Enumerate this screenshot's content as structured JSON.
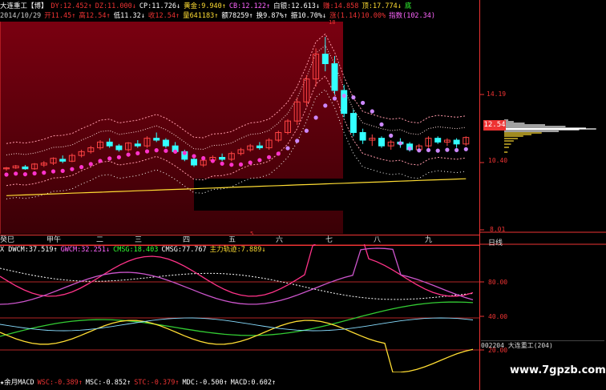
{
  "header": {
    "row1": [
      {
        "text": "大连重工【博】",
        "color": "#ffffff"
      },
      {
        "text": "DY:12.452↑",
        "color": "#e33"
      },
      {
        "text": "DZ:11.000↓",
        "color": "#e33"
      },
      {
        "text": "CP:11.726↓",
        "color": "#ffffff"
      },
      {
        "text": "黄金:9.940↑",
        "color": "#ffdd33"
      },
      {
        "text": "CB:12.122↑",
        "color": "#ff66ff"
      },
      {
        "text": "白银:12.613↓",
        "color": "#ffffff"
      },
      {
        "text": "赚:14.858",
        "color": "#e33"
      },
      {
        "text": "顶:17.774↓",
        "color": "#ffdd33"
      },
      {
        "text": "底",
        "color": "#33ff33"
      }
    ],
    "row2": [
      {
        "text": "2014/10/29",
        "color": "#cccccc"
      },
      {
        "text": "开11.45↑",
        "color": "#e33"
      },
      {
        "text": "高12.54↑",
        "color": "#e33"
      },
      {
        "text": "低11.32↓",
        "color": "#ffffff"
      },
      {
        "text": "收12.54↑",
        "color": "#e33"
      },
      {
        "text": "量641183↑",
        "color": "#ffdd33"
      },
      {
        "text": "额78259↑",
        "color": "#ffffff"
      },
      {
        "text": "换9.87%↑",
        "color": "#ffffff"
      },
      {
        "text": "振10.70%↓",
        "color": "#ffffff"
      },
      {
        "text": "涨(1.14)10.00%",
        "color": "#e33"
      },
      {
        "text": "指数(102.34)",
        "color": "#ff66ff"
      }
    ]
  },
  "price_axis": {
    "top_label": "18",
    "labels": [
      "14.19",
      "10.40",
      "8.01"
    ],
    "current": "12.54"
  },
  "week_bar": {
    "labels": [
      "癸巳",
      "甲午",
      "二",
      "三",
      "四",
      "五",
      "六",
      "七",
      "八",
      "九"
    ],
    "right_label": "日线",
    "marker": "5"
  },
  "indicator": {
    "legend": [
      {
        "text": "X DWCM:37.519↑",
        "color": "#ffffff"
      },
      {
        "text": "GWCM:32.251↓",
        "color": "#ff66ff"
      },
      {
        "text": "CMSG:18.403",
        "color": "#33ff33"
      },
      {
        "text": "CMSG:77.767",
        "color": "#ffffff"
      },
      {
        "text": "主力轨迹:7.889↓",
        "color": "#ffdd33"
      }
    ],
    "axis_labels": [
      "80.00",
      "40.00",
      "20.00"
    ]
  },
  "footer": {
    "legend": [
      {
        "text": "★余月MACD",
        "color": "#ffffff"
      },
      {
        "text": "WSC:-0.389↑",
        "color": "#e33"
      },
      {
        "text": "MSC:-0.852↑",
        "color": "#ffffff"
      },
      {
        "text": "STC:-0.379↑",
        "color": "#e33"
      },
      {
        "text": "MDC:-0.500↑",
        "color": "#ffffff"
      },
      {
        "text": "MACD:0.602↑",
        "color": "#ffffff"
      }
    ]
  },
  "stock_box": {
    "code": "002204",
    "name": "大连重工",
    "suffix": "(204)"
  },
  "watermark": "www.7gpzb.com",
  "candles": [
    [
      10.9,
      11.0,
      10.8,
      10.95
    ],
    [
      10.95,
      11.1,
      10.9,
      11.05
    ],
    [
      11.0,
      11.1,
      10.85,
      10.9
    ],
    [
      10.9,
      11.2,
      10.85,
      11.15
    ],
    [
      11.1,
      11.3,
      11.0,
      11.2
    ],
    [
      11.2,
      11.5,
      11.1,
      11.45
    ],
    [
      11.4,
      11.6,
      11.2,
      11.3
    ],
    [
      11.3,
      11.7,
      11.25,
      11.6
    ],
    [
      11.6,
      11.9,
      11.5,
      11.8
    ],
    [
      11.8,
      12.1,
      11.7,
      12.0
    ],
    [
      12.0,
      12.4,
      11.9,
      12.3
    ],
    [
      12.3,
      12.5,
      12.0,
      12.1
    ],
    [
      12.1,
      12.2,
      11.8,
      11.9
    ],
    [
      11.9,
      12.3,
      11.8,
      12.25
    ],
    [
      12.2,
      12.4,
      12.0,
      12.1
    ],
    [
      12.1,
      12.6,
      12.0,
      12.5
    ],
    [
      12.5,
      12.8,
      12.3,
      12.4
    ],
    [
      12.4,
      12.5,
      12.0,
      12.1
    ],
    [
      12.1,
      12.3,
      11.7,
      11.8
    ],
    [
      11.8,
      11.9,
      11.3,
      11.4
    ],
    [
      11.4,
      11.5,
      11.0,
      11.1
    ],
    [
      11.1,
      11.4,
      11.0,
      11.35
    ],
    [
      11.35,
      11.6,
      11.2,
      11.5
    ],
    [
      11.5,
      11.7,
      11.3,
      11.4
    ],
    [
      11.4,
      11.8,
      11.3,
      11.7
    ],
    [
      11.7,
      12.0,
      11.6,
      11.9
    ],
    [
      11.9,
      12.2,
      11.8,
      12.1
    ],
    [
      12.1,
      12.3,
      11.9,
      12.0
    ],
    [
      12.0,
      12.5,
      11.9,
      12.4
    ],
    [
      12.4,
      12.9,
      12.3,
      12.8
    ],
    [
      12.8,
      13.5,
      12.7,
      13.4
    ],
    [
      13.4,
      14.6,
      13.2,
      14.4
    ],
    [
      14.4,
      15.8,
      14.2,
      15.6
    ],
    [
      15.6,
      17.2,
      15.2,
      16.9
    ],
    [
      16.9,
      17.8,
      16.0,
      16.4
    ],
    [
      16.4,
      16.8,
      14.8,
      15.0
    ],
    [
      15.0,
      15.3,
      13.6,
      13.8
    ],
    [
      13.8,
      14.0,
      12.6,
      12.8
    ],
    [
      12.8,
      13.0,
      12.2,
      12.4
    ],
    [
      12.4,
      12.7,
      12.1,
      12.5
    ],
    [
      12.5,
      12.6,
      12.0,
      12.1
    ],
    [
      12.1,
      12.4,
      11.9,
      12.3
    ],
    [
      12.3,
      12.5,
      12.0,
      12.2
    ],
    [
      12.2,
      12.3,
      11.8,
      11.9
    ],
    [
      11.9,
      12.2,
      11.8,
      12.1
    ],
    [
      12.1,
      12.6,
      12.0,
      12.5
    ],
    [
      12.5,
      12.6,
      12.2,
      12.3
    ],
    [
      12.3,
      12.5,
      12.1,
      12.4
    ],
    [
      12.4,
      12.5,
      12.0,
      12.2
    ],
    [
      12.2,
      12.6,
      12.1,
      12.54
    ]
  ]
}
